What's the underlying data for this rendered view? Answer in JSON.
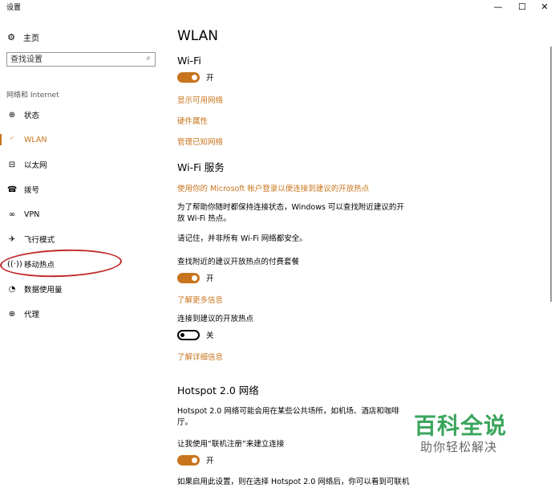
{
  "window": {
    "title": "设置",
    "minimize": "—",
    "maximize": "☐",
    "close": "✕"
  },
  "sidebar": {
    "home": {
      "label": "主页",
      "icon": "gear-icon"
    },
    "search_placeholder": "查找设置",
    "search_icon": "search-icon",
    "section": "网络和 Internet",
    "items": [
      {
        "label": "状态",
        "icon": "globe-status-icon",
        "active": false
      },
      {
        "label": "WLAN",
        "icon": "wifi-icon",
        "active": true
      },
      {
        "label": "以太网",
        "icon": "ethernet-icon",
        "active": false
      },
      {
        "label": "拨号",
        "icon": "dialup-icon",
        "active": false
      },
      {
        "label": "VPN",
        "icon": "vpn-icon",
        "active": false
      },
      {
        "label": "飞行模式",
        "icon": "airplane-icon",
        "active": false
      },
      {
        "label": "移动热点",
        "icon": "hotspot-icon",
        "active": false
      },
      {
        "label": "数据使用量",
        "icon": "data-usage-icon",
        "active": false
      },
      {
        "label": "代理",
        "icon": "globe-proxy-icon",
        "active": false
      }
    ]
  },
  "main": {
    "title": "WLAN",
    "wifi": {
      "heading": "Wi-Fi",
      "toggle_label": "开",
      "toggle_on": true,
      "links": [
        "显示可用网络",
        "硬件属性",
        "管理已知网络"
      ]
    },
    "wifi_service": {
      "heading": "Wi-Fi 服务",
      "link": "使用你的 Microsoft 帐户登录以便连接到建议的开放热点",
      "desc_line1": "为了帮助你随时都保持连接状态，Windows 可以查找附近建议的开",
      "desc_line2": "放 Wi-Fi 热点。",
      "note": "请记住，并非所有 Wi-Fi 网络都安全。",
      "paid_label": "查找附近的建议开放热点的付费套餐",
      "paid_toggle_label": "开",
      "paid_toggle_on": true,
      "more_info": "了解更多信息",
      "connect_label": "连接到建议的开放热点",
      "connect_toggle_label": "关",
      "connect_toggle_on": false,
      "details": "了解详细信息"
    },
    "hotspot20": {
      "heading": "Hotspot 2.0 网络",
      "desc_line1": "Hotspot 2.0 网络可能会用在某些公共场所，如机场、酒店和咖啡",
      "desc_line2": "厅。",
      "signup_label": "让我使用“联机注册”来建立连接",
      "signup_toggle_label": "开",
      "signup_toggle_on": true,
      "cut_line": "如果启用此设置，则在选择 Hotspot 2.0 网络后，你可以看到可联机"
    }
  },
  "watermark": {
    "main": "百科全说",
    "sub": "助你轻松解决"
  },
  "colors": {
    "accent": "#c8741d",
    "annotation": "#c12a2a",
    "watermark": "#3aa55c"
  }
}
